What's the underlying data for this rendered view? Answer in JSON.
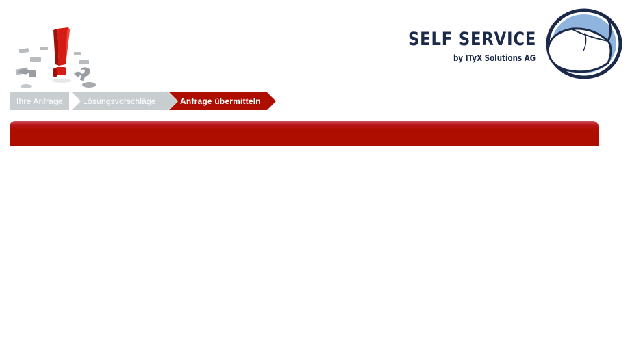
{
  "logo": {
    "title": "SELF SERVICE",
    "subtitle": "by ITyX Solutions AG",
    "icon": "mouse-icon"
  },
  "hero": {
    "icon": "exclamation-question-illustration-icon"
  },
  "steps": [
    {
      "label": "Ihre Anfrage",
      "state": "done"
    },
    {
      "label": "Lösungsvorschläge",
      "state": "done"
    },
    {
      "label": "Anfrage übermitteln",
      "state": "active"
    }
  ],
  "colors": {
    "brand_navy": "#1c2a4a",
    "brand_blue": "#8fb4de",
    "accent_red": "#ae0e00",
    "step_inactive": "#c8cdd0"
  }
}
